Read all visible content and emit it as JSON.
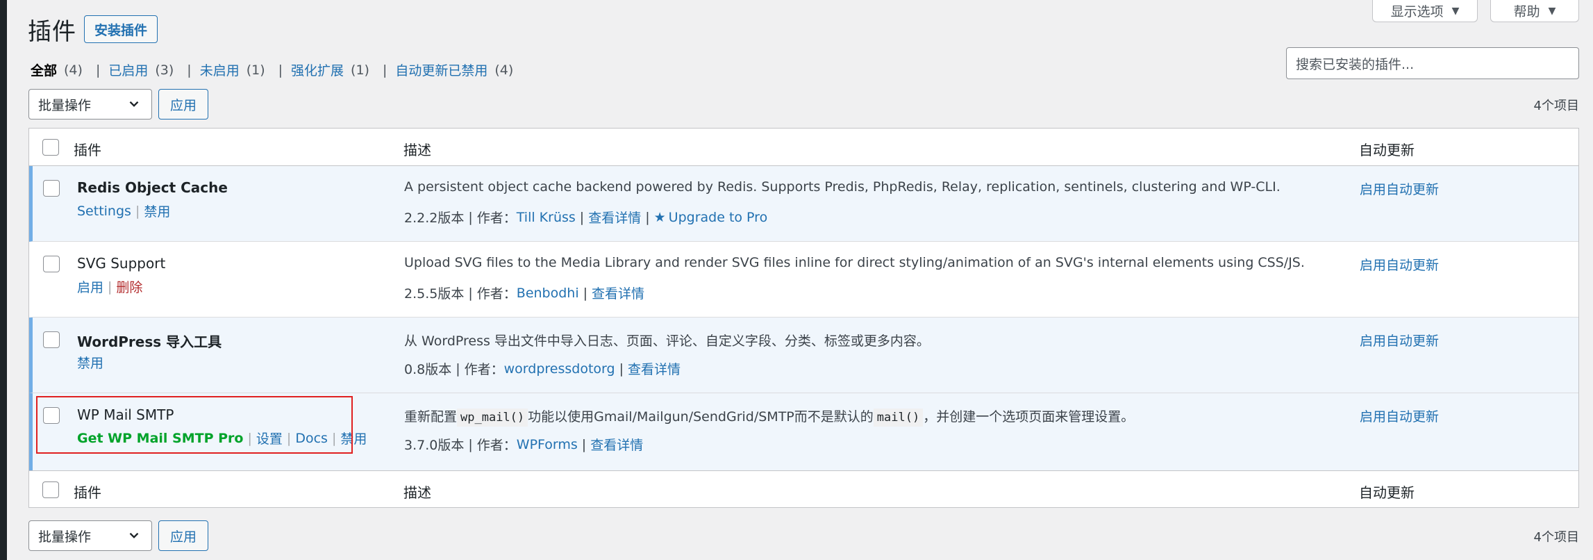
{
  "screen_options": {
    "options_label": "显示选项",
    "help_label": "帮助"
  },
  "page": {
    "title": "插件",
    "add_new": "安装插件"
  },
  "filters": [
    {
      "label": "全部",
      "count": "(4)"
    },
    {
      "label": "已启用",
      "count": "(3)"
    },
    {
      "label": "未启用",
      "count": "(1)"
    },
    {
      "label": "强化扩展",
      "count": "(1)"
    },
    {
      "label": "自动更新已禁用",
      "count": "(4)"
    }
  ],
  "search": {
    "placeholder": "搜索已安装的插件..."
  },
  "tablenav": {
    "bulk_label": "批量操作",
    "apply_label": "应用",
    "items_count": "4个项目"
  },
  "columns": {
    "plugin": "插件",
    "description": "描述",
    "auto_updates": "自动更新"
  },
  "plugins": [
    {
      "name": "Redis Object Cache",
      "status": "active",
      "actions": [
        "Settings",
        "禁用"
      ],
      "description": "A persistent object cache backend powered by Redis. Supports Predis, PhpRedis, Relay, replication, sentinels, clustering and WP-CLI.",
      "version": "2.2.2版本",
      "author_prefix": "作者：",
      "author": "Till Krüss",
      "details": "查看详情",
      "extra": "Upgrade to Pro",
      "auto_update": "启用自动更新"
    },
    {
      "name": "SVG Support",
      "status": "inactive",
      "actions": [
        "启用",
        "删除"
      ],
      "description": "Upload SVG files to the Media Library and render SVG files inline for direct styling/animation of an SVG's internal elements using CSS/JS.",
      "version": "2.5.5版本",
      "author_prefix": "作者：",
      "author": "Benbodhi",
      "details": "查看详情",
      "auto_update": "启用自动更新"
    },
    {
      "name": "WordPress 导入工具",
      "status": "active",
      "actions": [
        "禁用"
      ],
      "description": "从 WordPress 导出文件中导入日志、页面、评论、自定义字段、分类、标签或更多内容。",
      "version": "0.8版本",
      "author_prefix": "作者：",
      "author": "wordpressdotorg",
      "details": "查看详情",
      "auto_update": "启用自动更新"
    },
    {
      "name": "WP Mail SMTP",
      "status": "active",
      "actions": [
        "Get WP Mail SMTP Pro",
        "设置",
        "Docs",
        "禁用"
      ],
      "description_parts": [
        "重新配置",
        "wp_mail()",
        "功能以使用Gmail/Mailgun/SendGrid/SMTP而不是默认的",
        "mail()",
        "，并创建一个选项页面来管理设置。"
      ],
      "version": "3.7.0版本",
      "author_prefix": "作者：",
      "author": "WPForms",
      "details": "查看详情",
      "auto_update": "启用自动更新"
    }
  ],
  "colors": {
    "link": "#2271b1",
    "active_bg": "#f0f6fc",
    "active_border": "#72aee6",
    "delete": "#b32d2e",
    "pro": "#00a32a",
    "highlight": "#e02020"
  }
}
